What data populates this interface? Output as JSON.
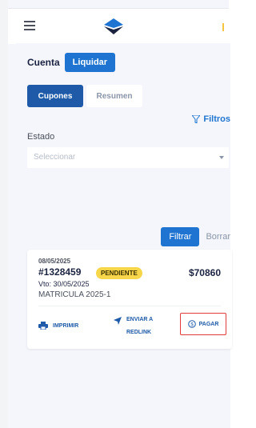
{
  "header": {
    "icons": {
      "menu": "hamburger-icon",
      "logo": "brand-logo"
    }
  },
  "account": {
    "label": "Cuenta",
    "liquidar_button": "Liquidar"
  },
  "tabs": [
    {
      "label": "Cupones",
      "active": true
    },
    {
      "label": "Resumen",
      "active": false
    }
  ],
  "filters": {
    "link_label": "Filtros",
    "estado_label": "Estado",
    "select_placeholder": "Seleccionar",
    "apply_label": "Filtrar",
    "clear_label": "Borrar"
  },
  "coupon": {
    "date": "08/05/2025",
    "number": "#1328459",
    "status": "PENDIENTE",
    "amount": "$70860",
    "due": "Vto: 30/05/2025",
    "description": "MATRICULA 2025-1",
    "actions": {
      "print": "IMPRIMIR",
      "send_line1": "ENVIAR A",
      "send_line2": "REDLINK",
      "pay": "PAGAR"
    }
  },
  "colors": {
    "primary": "#1e74d0",
    "tab_active": "#1e5aa8",
    "badge": "#f7d64a",
    "highlight_border": "#e03a3a",
    "background": "#f4f6fb"
  }
}
